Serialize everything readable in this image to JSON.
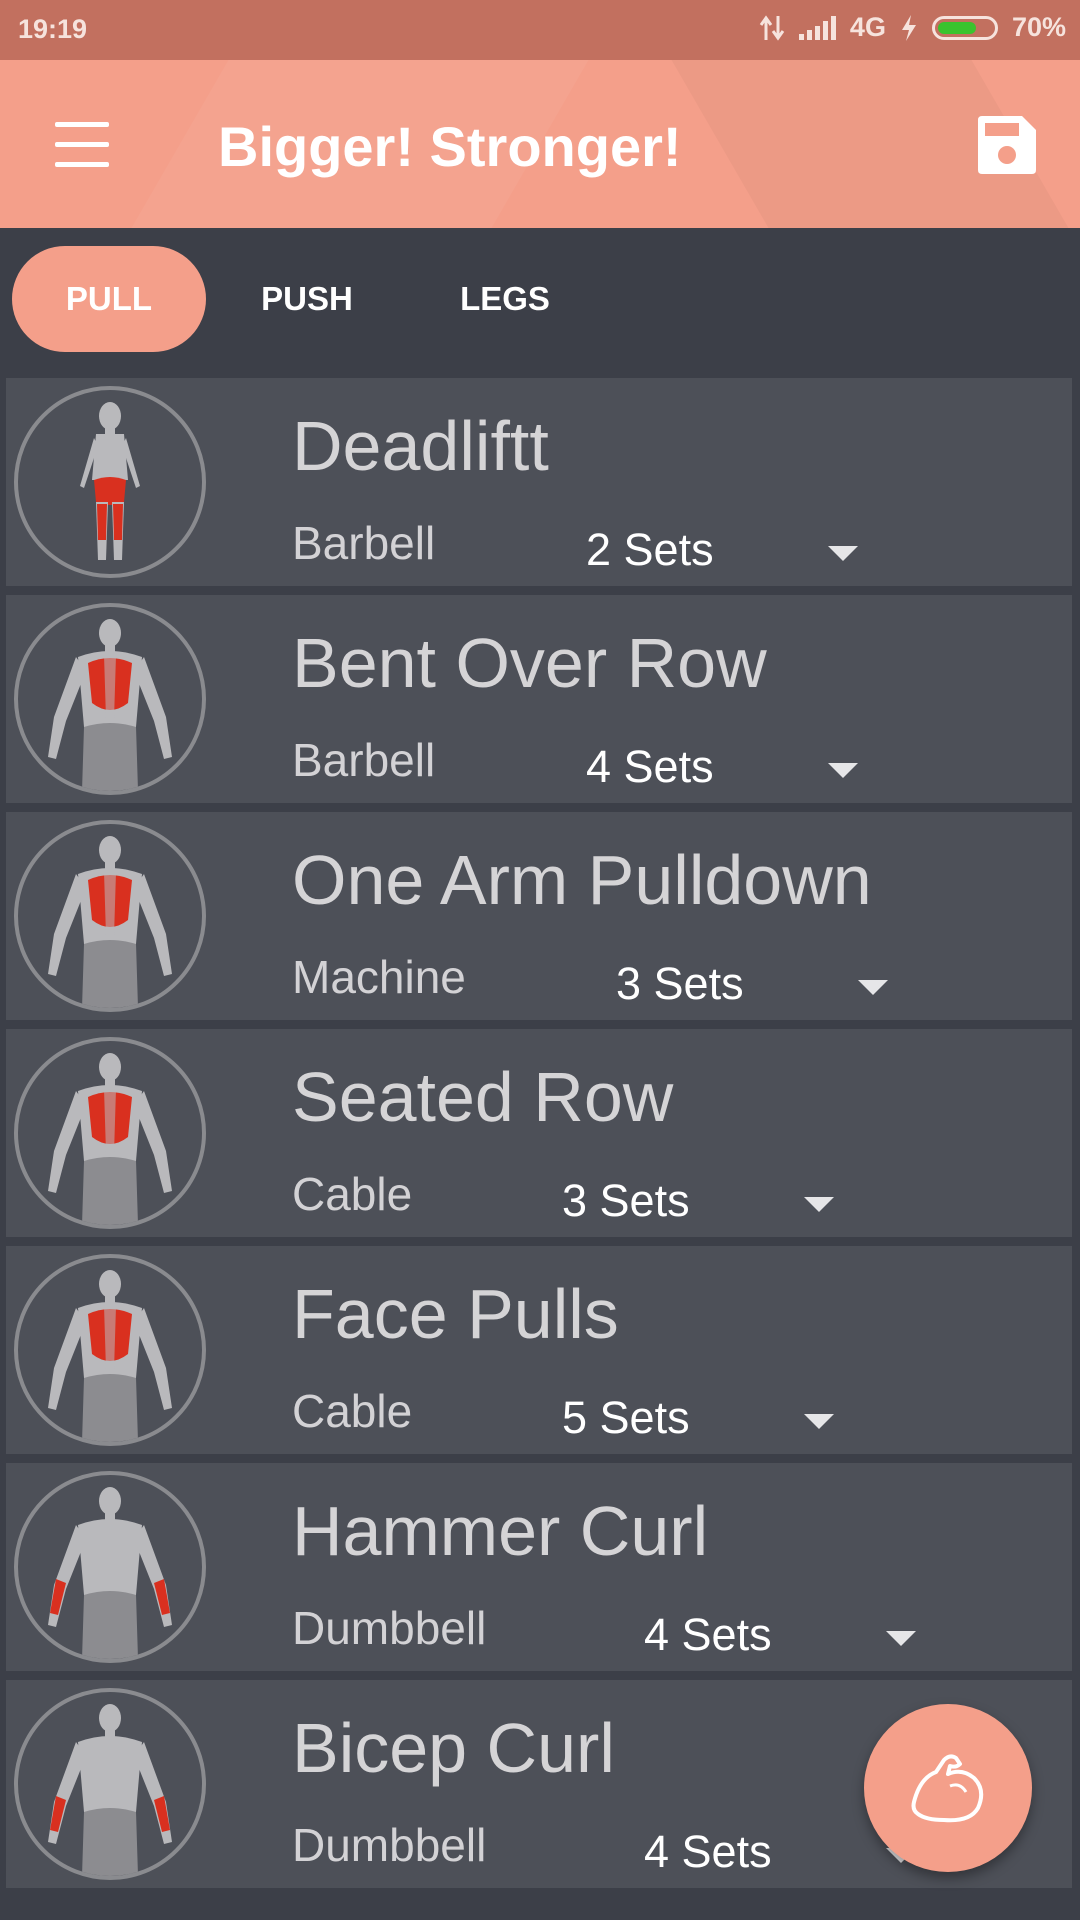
{
  "status_bar": {
    "time": "19:19",
    "network": "4G",
    "battery_percent": "70%",
    "battery_level": 0.7
  },
  "app_bar": {
    "title": "Bigger! Stronger!",
    "menu_icon": "hamburger-menu-icon",
    "save_icon": "floppy-disk-icon"
  },
  "tabs": [
    {
      "label": "PULL",
      "active": true
    },
    {
      "label": "PUSH",
      "active": false
    },
    {
      "label": "LEGS",
      "active": false
    }
  ],
  "exercises": [
    {
      "name": "Deadliftt",
      "equipment": "Barbell",
      "sets": "2 Sets",
      "muscle_view": "back-legs"
    },
    {
      "name": "Bent Over Row",
      "equipment": "Barbell",
      "sets": "4 Sets",
      "muscle_view": "back"
    },
    {
      "name": "One Arm Pulldown",
      "equipment": "Machine",
      "sets": "3 Sets",
      "muscle_view": "back"
    },
    {
      "name": "Seated Row",
      "equipment": "Cable",
      "sets": "3 Sets",
      "muscle_view": "back"
    },
    {
      "name": "Face Pulls",
      "equipment": "Cable",
      "sets": "5 Sets",
      "muscle_view": "back"
    },
    {
      "name": "Hammer Curl",
      "equipment": "Dumbbell",
      "sets": "4 Sets",
      "muscle_view": "front-forearms"
    },
    {
      "name": "Bicep Curl",
      "equipment": "Dumbbell",
      "sets": "4 Sets",
      "muscle_view": "front-forearms"
    }
  ],
  "fab": {
    "icon": "flexed-bicep-icon"
  },
  "colors": {
    "accent": "#f49f8a",
    "status_bar": "#c2705f",
    "background": "#3c3f48",
    "row": "#4d5058",
    "muscle_highlight": "#d9301f"
  }
}
